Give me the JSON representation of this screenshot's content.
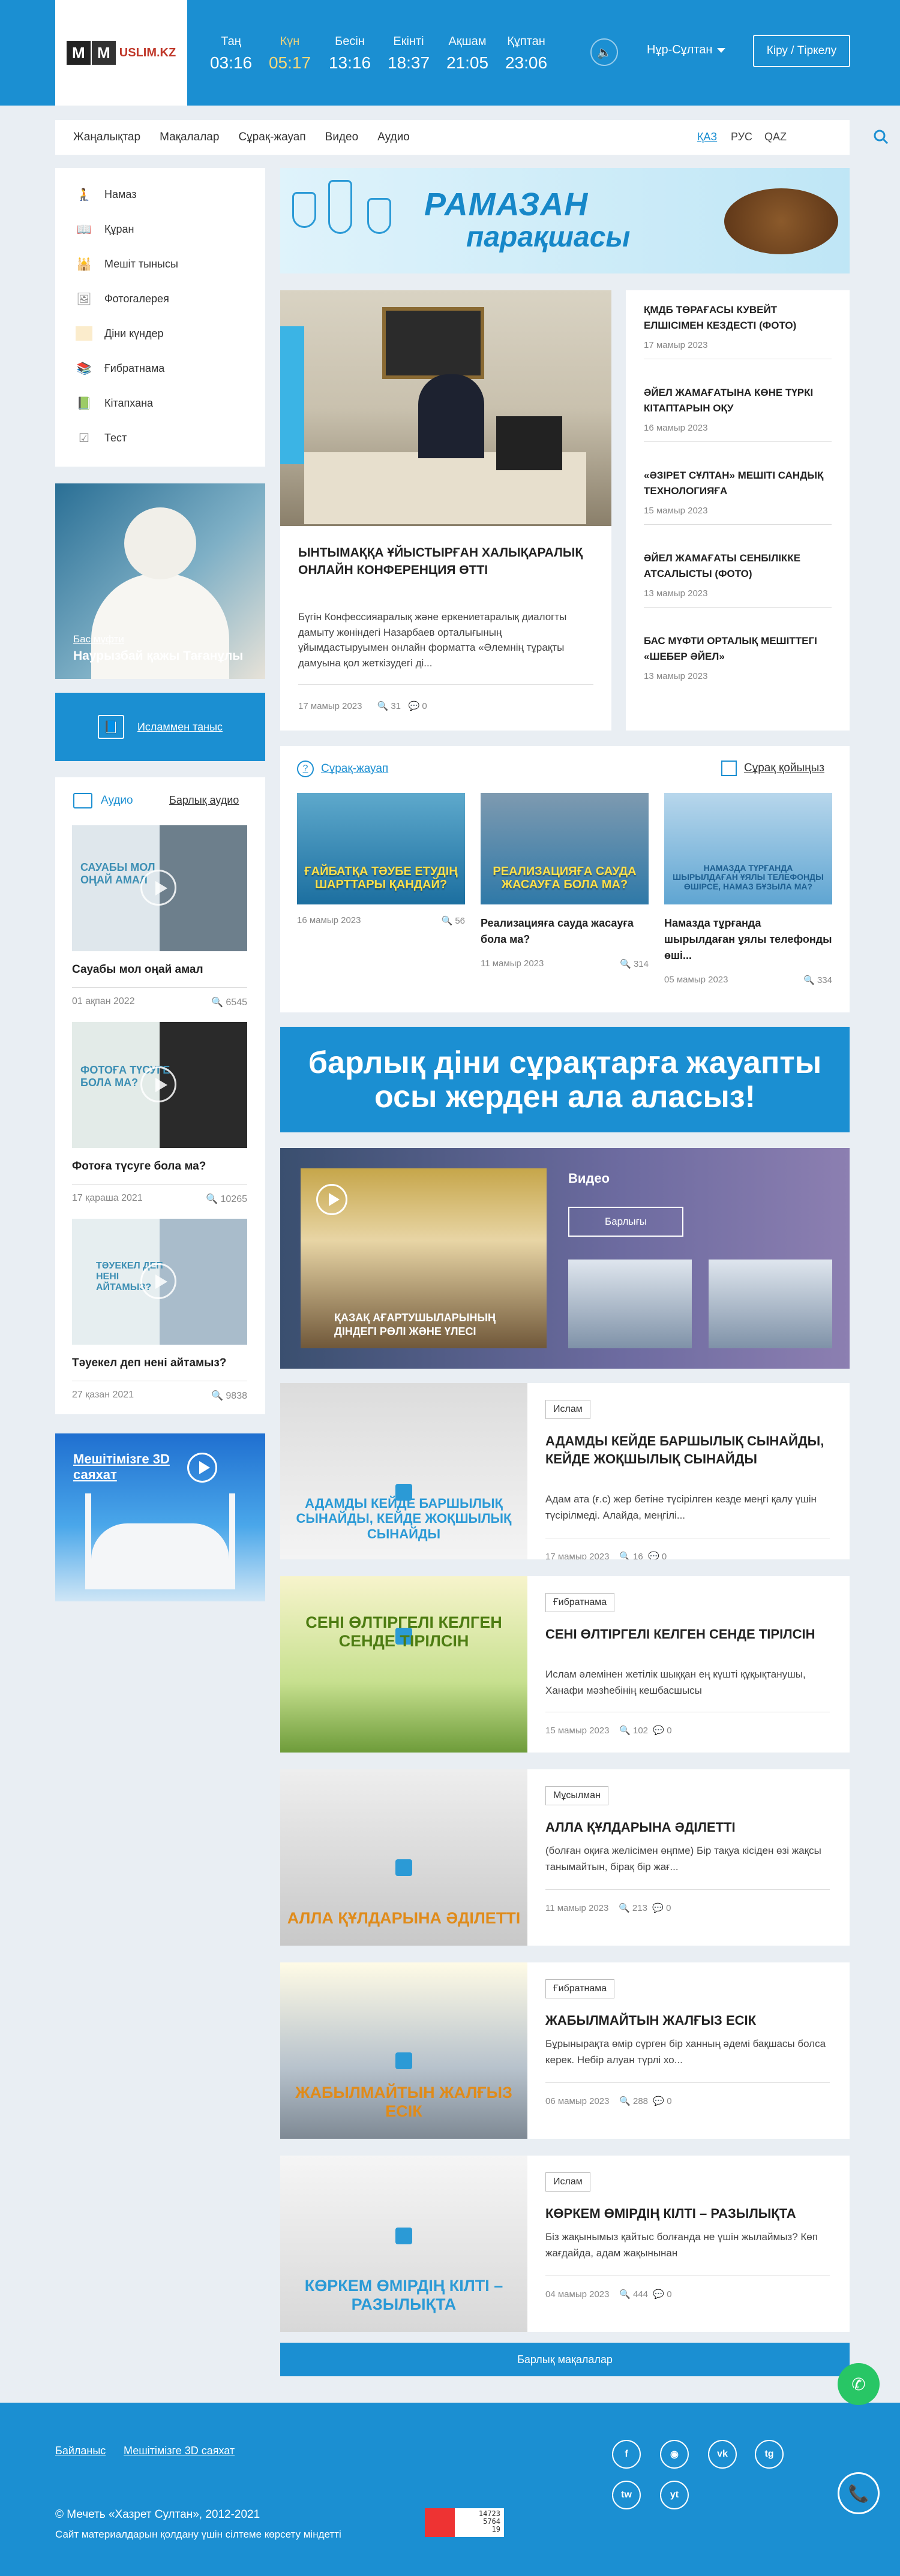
{
  "header": {
    "logo": "USLIM.KZ",
    "prayers": [
      {
        "name": "Таң",
        "time": "03:16"
      },
      {
        "name": "Күн",
        "time": "05:17"
      },
      {
        "name": "Бесін",
        "time": "13:16"
      },
      {
        "name": "Екінті",
        "time": "18:37"
      },
      {
        "name": "Ақшам",
        "time": "21:05"
      },
      {
        "name": "Құптан",
        "time": "23:06"
      }
    ],
    "city": "Нұр-Сұлтан",
    "login": "Кіру / Тіркелу"
  },
  "nav": {
    "items": [
      "Жаңалықтар",
      "Мақалалар",
      "Сұрақ-жауап",
      "Видео",
      "Аудио"
    ],
    "langs": [
      "ҚАЗ",
      "РУС",
      "QAZ"
    ]
  },
  "sidebar": {
    "menu": [
      "Намаз",
      "Құран",
      "Мешіт тынысы",
      "Фотогалерея",
      "Діни күндер",
      "Ғибратнама",
      "Кітапхана",
      "Тест"
    ],
    "mufti_tag": "Бас мүфти",
    "mufti_name": "Наурызбай қажы Тағанұлы",
    "islam_label": "Исламмен таныс",
    "audio_title": "Аудио",
    "audio_all": "Барлық аудио",
    "audio": [
      {
        "title": "Сауабы мол оңай амал",
        "date": "01 ақпан 2022",
        "views": "6545",
        "img": "САУАБЫ МОЛ ОҢАЙ АМАЛ"
      },
      {
        "title": "Фотоға түсуге бола ма?",
        "date": "17 қараша 2021",
        "views": "10265",
        "img": "ФОТОҒА ТҮСУГЕ БОЛА МА?"
      },
      {
        "title": "Тәуекел деп нені айтамыз?",
        "date": "27 қазан 2021",
        "views": "9838",
        "img": "ТӘУЕКЕЛ ДЕП НЕНІ АЙТАМЫЗ?"
      }
    ],
    "tour_title": "Мешітімізге 3D саяхат"
  },
  "ramadan": {
    "line1": "РАМАЗАН",
    "line2": "парақшасы"
  },
  "featured": {
    "title": "ЫНТЫМАҚҚА ҰЙЫСТЫРҒАН ХАЛЫҚАРАЛЫҚ ОНЛАЙН КОНФЕРЕНЦИЯ ӨТТІ",
    "text": "Бүгін Конфессияаралық және еркениетаралық диалогты дамыту жөніндегі Назарбаев орталығының ұйымдастыруымен онлайн форматта «Әлемнің тұрақты дамуына қол жеткізудегі ді...",
    "date": "17 мамыр 2023",
    "views": "31",
    "comments": "0"
  },
  "news": [
    {
      "title": "ҚМДБ ТӨРАҒАСЫ КУВЕЙТ ЕЛШІСІМЕН КЕЗДЕСТІ (ФОТО)",
      "date": "17 мамыр 2023"
    },
    {
      "title": "ӘЙЕЛ ЖАМАҒАТЫНА КӨНЕ ТҮРКІ КІТАПТАРЫН ОҚУ",
      "date": "16 мамыр 2023"
    },
    {
      "title": "«ӘЗІРЕТ СҰЛТАН» МЕШІТІ САНДЫҚ ТЕХНОЛОГИЯҒА",
      "date": "15 мамыр 2023"
    },
    {
      "title": "ӘЙЕЛ ЖАМАҒАТЫ СЕНБІЛІККЕ АТСАЛЫСТЫ (ФОТО)",
      "date": "13 мамыр 2023"
    },
    {
      "title": "БАС МҮФТИ ОРТАЛЫҚ МЕШІТТЕГІ «ШЕБЕР ӘЙЕЛ»",
      "date": "13 мамыр 2023"
    }
  ],
  "qa": {
    "title": "Сұрақ-жауап",
    "ask": "Сұрақ қойыңыз",
    "cards": [
      {
        "img": "ҒАЙБАТҚА ТӘУБЕ ЕТУДІҢ ШАРТТАРЫ ҚАНДАЙ?",
        "title": "",
        "date": "16 мамыр 2023",
        "views": "56"
      },
      {
        "img": "РЕАЛИЗАЦИЯҒА САУДА ЖАСАУҒА БОЛА МА?",
        "title": "Реализацияға сауда жасауға бола ма?",
        "date": "11 мамыр 2023",
        "views": "314"
      },
      {
        "img": "НАМАЗДА ТҮРҒАНДА ШЫРЫЛДАҒАН ҰЯЛЫ ТЕЛЕФОНДЫ ӨШІРСЕ, НАМАЗ БҰЗЫЛА МА?",
        "title": "Намазда тұрғанда шырылдаған ұялы телефонды өші...",
        "date": "05 мамыр 2023",
        "views": "334"
      }
    ]
  },
  "qbanner": {
    "line1": "барлық діни сұрақтарға жауапты",
    "line2": "осы жерден ала аласыз!"
  },
  "video": {
    "main_caption": "ҚАЗАҚ АҒАРТУШЫЛАРЫНЫҢ ДІНДЕГІ РӨЛІ ЖӘНЕ ҮЛЕСІ",
    "label": "Видео",
    "all": "Барлығы"
  },
  "articles": [
    {
      "badge": "Ислам",
      "title": "АДАМДЫ КЕЙДЕ БАРШЫЛЫҚ СЫНАЙДЫ, КЕЙДЕ ЖОҚШЫЛЫҚ СЫНАЙДЫ",
      "text": "Адам ата (ғ.с) жер бетіне түсірілген кезде меңгі қалу үшін түсірілмеді. Алайда, меңгілі...",
      "date": "17 мамыр 2023",
      "views": "16",
      "comments": "0",
      "img": "АДАМДЫ КЕЙДЕ БАРШЫЛЫҚ СЫНАЙДЫ, КЕЙДЕ ЖОҚШЫЛЫҚ СЫНАЙДЫ"
    },
    {
      "badge": "Ғибратнама",
      "title": "СЕНІ ӨЛТІРГЕЛІ КЕЛГЕН СЕНДЕ ТІРІЛСІН",
      "text": "Ислам әлемінен жетілік шыққан ең күшті құқықтанушы, Ханафи мәзһебінің кешбасшысы",
      "date": "15 мамыр 2023",
      "views": "102",
      "comments": "0",
      "img": "СЕНІ ӨЛТІРГЕЛІ КЕЛГЕН СЕНДЕ ТІРІЛСІН"
    },
    {
      "badge": "Мұсылман",
      "title": "АЛЛА ҚҰЛДАРЫНА ӘДІЛЕТТІ",
      "text": "(болған оқиға желісімен өңпме) Бір тақуа кісіден өзі жақсы танымайтын, бірақ бір жағ...",
      "date": "11 мамыр 2023",
      "views": "213",
      "comments": "0",
      "img": "АЛЛА ҚҰЛДАРЫНА ӘДІЛЕТТІ"
    },
    {
      "badge": "Ғибратнама",
      "title": "ЖАБЫЛМАЙТЫН ЖАЛҒЫЗ ЕСІК",
      "text": " Бұрынырақта өмір сүрген бір ханның әдемі бақшасы болса керек. Небір алуан түрлі хо...",
      "date": "06 мамыр 2023",
      "views": "288",
      "comments": "0",
      "img": "ЖАБЫЛМАЙТЫН ЖАЛҒЫЗ ЕСІК"
    },
    {
      "badge": "Ислам",
      "title": "КӨРКЕМ ӨМІРДІҢ КІЛТІ – РАЗЫЛЫҚТА",
      "text": "Біз жақынымыз қайтыс болғанда не үшін жылаймыз? Көп жағдайда, адам жақынынан",
      "date": "04 мамыр 2023",
      "views": "444",
      "comments": "0",
      "img": "КӨРКЕМ ӨМІРДІҢ КІЛТІ – РАЗЫЛЫҚТА"
    }
  ],
  "all_articles": "Барлық мақалалар",
  "footer": {
    "links": [
      "Байланыс",
      "Мешітімізге 3D саяхат"
    ],
    "social": [
      "f",
      "◉",
      "vk",
      "tg",
      "tw",
      "yt"
    ],
    "copyright": "© Мечеть «Хазрет Султан», 2012-2021",
    "rights": "Сайт материалдарын қолдану үшін сілтеме көрсету міндетті",
    "counter": [
      "14723",
      "5764",
      "19"
    ]
  }
}
